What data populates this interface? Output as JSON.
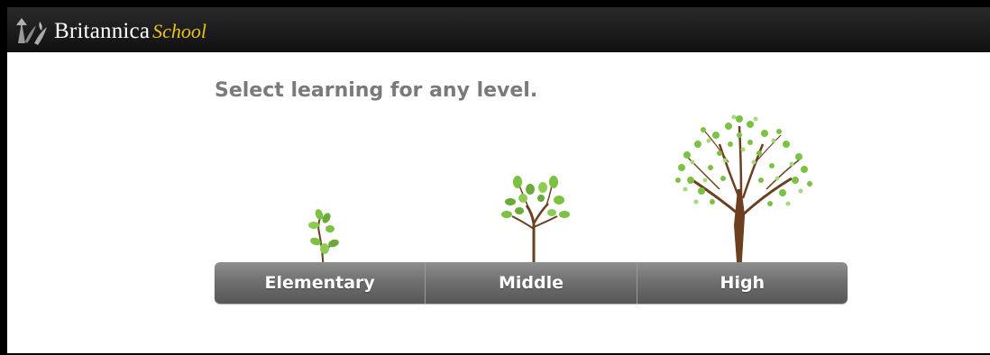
{
  "header": {
    "brand_main": "Britannica",
    "brand_sub": "School",
    "logo_icon": "thistle-icon",
    "colors": {
      "bar": "#1a1a1a",
      "brand_main": "#ffffff",
      "brand_sub": "#e8c21d"
    }
  },
  "main": {
    "heading": "Select learning for any level.",
    "levels": [
      {
        "label": "Elementary",
        "icon": "sapling-icon"
      },
      {
        "label": "Middle",
        "icon": "young-tree-icon"
      },
      {
        "label": "High",
        "icon": "full-tree-icon"
      }
    ],
    "colors": {
      "heading": "#7a7a7a",
      "leaf": "#7cc242",
      "trunk": "#6b3f1f",
      "button": "#6f6f6f"
    }
  }
}
